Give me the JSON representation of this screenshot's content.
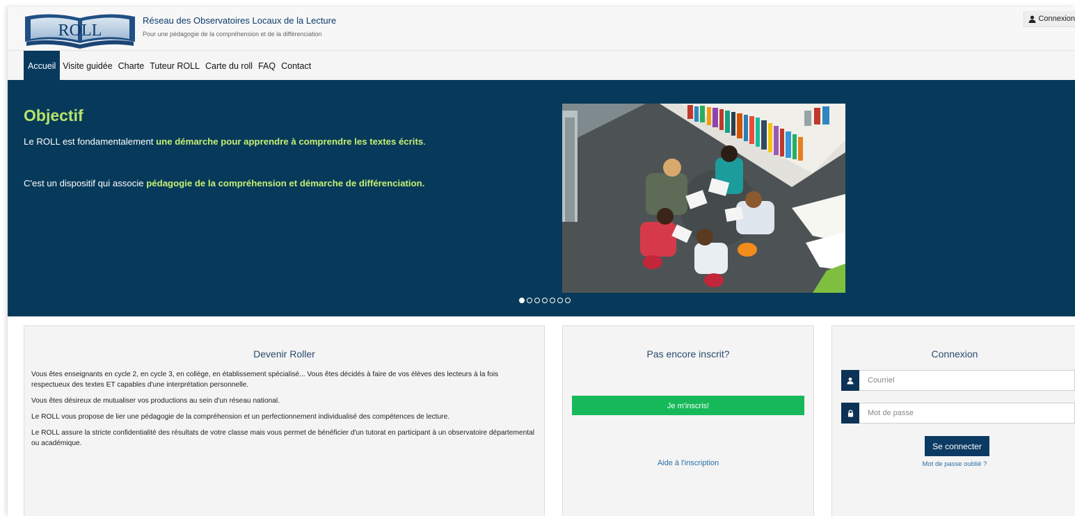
{
  "header": {
    "logo_text": "ROLL",
    "title": "Réseau des Observatoires Locaux de la Lecture",
    "subtitle": "Pour une pédagogie de la compréhension et de la différenciation",
    "connexion_label": "Connexion"
  },
  "nav": {
    "items": [
      {
        "label": "Accueil"
      },
      {
        "label": "Visite guidée"
      },
      {
        "label": "Charte"
      },
      {
        "label": "Tuteur ROLL"
      },
      {
        "label": "Carte du roll"
      },
      {
        "label": "FAQ"
      },
      {
        "label": "Contact"
      }
    ],
    "active": "Accueil"
  },
  "hero": {
    "title": "Objectif",
    "p1_before": "Le ROLL est fondamentalement ",
    "p1_highlight": "une démarche pour apprendre à comprendre les textes écrits",
    "p1_after": ".",
    "p2_before": "C'est un dispositif qui associe ",
    "p2_highlight": "pédagogie de la compréhension et démarche de différenciation.",
    "slide_count": 7,
    "active_slide": 1
  },
  "roller": {
    "title": "Devenir Roller",
    "paragraphs": [
      "Vous êtes enseignants en cycle 2, en cycle 3, en collège, en établissement spécialisé... Vous êtes décidés à faire de vos élèves des lecteurs à la fois respectueux des textes ET capables d'une interprétation personnelle.",
      "Vous êtes désireux de mutualiser vos productions au sein d'un réseau national.",
      "Le ROLL vous propose de lier une pédagogie de la compréhension et un perfectionnement individualisé des compétences de lecture.",
      "Le ROLL assure la stricte confidentialité des résultats de votre classe mais vous permet de bénéficier d'un tutorat en participant à un observatoire départemental ou académique."
    ]
  },
  "signup": {
    "title": "Pas encore inscrit?",
    "button_label": "Je m'inscris!",
    "help_link": "Aide à l'inscription"
  },
  "login": {
    "title": "Connexion",
    "email_placeholder": "Courriel",
    "password_placeholder": "Mot de passe",
    "submit_label": "Se connecter",
    "forgot_link": "Mot de passe oublié ?"
  },
  "colors": {
    "brand_navy": "#073a5a",
    "highlight_green": "#c6ef74",
    "signup_green": "#16b95a"
  }
}
